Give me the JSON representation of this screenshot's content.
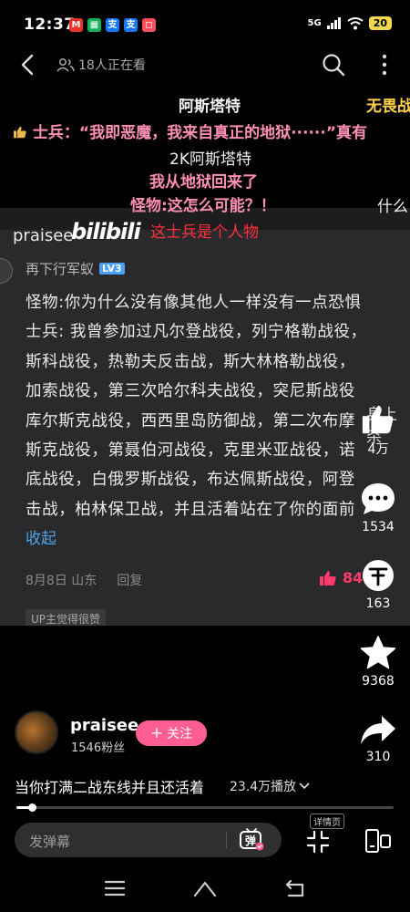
{
  "status_bar": {
    "time": "12:37",
    "apps": [
      {
        "name": "mcdonalds-icon",
        "glyph": "M",
        "color": "#e8322a"
      },
      {
        "name": "wechat-icon",
        "glyph": "▦",
        "color": "#13b35b"
      },
      {
        "name": "alipay-icon",
        "glyph": "支",
        "color": "#1677ff"
      },
      {
        "name": "alipay-icon-2",
        "glyph": "支",
        "color": "#1677ff"
      },
      {
        "name": "app-icon",
        "glyph": "◻",
        "color": "#ff4d5a"
      }
    ],
    "network": "5G",
    "battery": "20"
  },
  "top_nav": {
    "viewers": "18人正在看"
  },
  "danmaku": [
    {
      "text": "阿斯塔特",
      "style": "white"
    },
    {
      "text": "无畏战",
      "style": "gold"
    },
    {
      "text": "士兵：“我即恶魔，我来自真正的地狱······”真有",
      "style": "pink"
    },
    {
      "text": "2K阿斯塔特",
      "style": "white"
    },
    {
      "text": "我从地狱回来了",
      "style": "pink"
    },
    {
      "text": "怪物:这怎么可能？！",
      "style": "pink"
    },
    {
      "text": "这士兵是个人物",
      "style": "red"
    },
    {
      "text": "什么",
      "style": "white"
    }
  ],
  "video_card": {
    "brand": "praisee",
    "logo": "bilibili",
    "side_text": "身上杀",
    "commenter": "再下行军蚁",
    "commenter_level": "LV3",
    "comment_lines": [
      "怪物:你为什么没有像其他人一样没有一点恐惧",
      "士兵: 我曾参加过凡尔登战役，列宁格勒战役，",
      "斯科战役，热勒夫反击战，斯大林格勒战役，",
      "加索战役，第三次哈尔科夫战役，突尼斯战役",
      "库尔斯克战役，西西里岛防御战，第二次布摩",
      "斯克战役，第聂伯河战役，克里米亚战役，诺",
      "底战役，白俄罗斯战役，布达佩斯战役，阿登",
      "击战，柏林保卫战，并且活着站在了你的面前"
    ],
    "collapse": "收起",
    "date": "8月8日 山东",
    "reply": "回复",
    "likes": "84",
    "up_badge": "UP主觉得很赞"
  },
  "rail": {
    "like_count": "4万",
    "comment_count": "1534",
    "coin_count": "163",
    "favorite_count": "9368",
    "share_count": "310"
  },
  "author": {
    "name": "praisee",
    "fans": "1546粉丝",
    "follow": "关注"
  },
  "video": {
    "title": "当你打满二战东线并且还活着",
    "plays": "23.4万播放",
    "progress": 0.04
  },
  "bottom_bar": {
    "danmaku_placeholder": "发弹幕",
    "detail_label": "详情页"
  },
  "colors": {
    "accent_pink": "#ff5d93",
    "link_blue": "#4ea3e6"
  }
}
